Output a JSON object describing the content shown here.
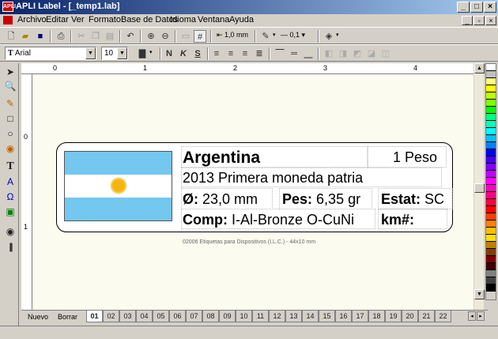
{
  "window": {
    "title": "APLI Label - [_temp1.lab]",
    "app_icon": "apli-icon"
  },
  "menu": [
    "Archivo",
    "Editar",
    "Ver",
    "Formato",
    "Base de Datos",
    "Idioma",
    "Ventana",
    "Ayuda"
  ],
  "toolbar1": {
    "line_width": "1,0 mm",
    "line_style": "0,1"
  },
  "toolbar2": {
    "font_name": "Arial",
    "font_size": "10",
    "bold": "N",
    "italic": "K",
    "underline": "S"
  },
  "ruler": {
    "top": [
      "0",
      "1",
      "2",
      "3",
      "4"
    ],
    "left": [
      "0",
      "1"
    ]
  },
  "label": {
    "title": "Argentina",
    "value": "1 Peso",
    "line2": "2013  Primera moneda patria",
    "diam_label": "Ø:",
    "diam_value": "23,0 mm",
    "weight_label": "Pes:",
    "weight_value": "6,35 gr",
    "status_label": "Estat:",
    "status_value": "SC",
    "comp_label": "Comp:",
    "comp_value": "I-Al-Bronze O-CuNi",
    "km_label": "km#:"
  },
  "footer_note": "02006 Etiquetas para Dispositivos (I.L.C.) - 44x10 mm",
  "sheet_buttons": {
    "new": "Nuevo",
    "delete": "Borrar"
  },
  "page_tabs": [
    "01",
    "02",
    "03",
    "04",
    "05",
    "06",
    "07",
    "08",
    "09",
    "10",
    "11",
    "12",
    "13",
    "14",
    "15",
    "16",
    "17",
    "18",
    "19",
    "20",
    "21",
    "22"
  ],
  "palette": [
    "#ffffff",
    "#c0c0c0",
    "#ffff80",
    "#ffff00",
    "#c0ff00",
    "#80ff00",
    "#00ff00",
    "#00ff80",
    "#00ffc0",
    "#00ffff",
    "#00c0ff",
    "#0080ff",
    "#0000ff",
    "#4000ff",
    "#8000ff",
    "#c000ff",
    "#ff00ff",
    "#ff00c0",
    "#ff0080",
    "#ff0040",
    "#ff0000",
    "#ff4000",
    "#ff8000",
    "#ffc000",
    "#ffe000",
    "#c08000",
    "#804000",
    "#800000",
    "#400000",
    "#808080",
    "#404040",
    "#000000"
  ]
}
